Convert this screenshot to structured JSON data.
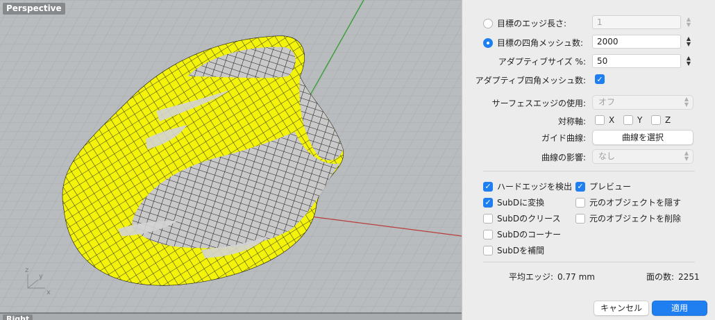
{
  "viewport": {
    "title": "Perspective",
    "second_title": "Right",
    "axis_labels": {
      "x": "x",
      "y": "y",
      "z": "z"
    }
  },
  "panel": {
    "edge_length": {
      "label": "目標のエッジ長さ:",
      "value": "1",
      "selected": false
    },
    "quad_count": {
      "label": "目標の四角メッシュ数:",
      "value": "2000",
      "selected": true
    },
    "adaptive_size": {
      "label": "アダプティブサイズ %:",
      "value": "50"
    },
    "adaptive_quad": {
      "label": "アダプティブ四角メッシュ数:",
      "checked": true
    },
    "surface_edges": {
      "label": "サーフェスエッジの使用:",
      "value": "オフ"
    },
    "symmetry": {
      "label": "対称軸:",
      "x": "X",
      "y": "Y",
      "z": "Z"
    },
    "guide_curves": {
      "label": "ガイド曲線:",
      "button": "曲線を選択"
    },
    "curve_influence": {
      "label": "曲線の影響:",
      "value": "なし"
    },
    "options": {
      "detect_hard_edges": {
        "label": "ハードエッジを検出",
        "checked": true
      },
      "preview": {
        "label": "プレビュー",
        "checked": true
      },
      "convert_subd": {
        "label": "SubDに変換",
        "checked": true
      },
      "hide_original": {
        "label": "元のオブジェクトを隠す",
        "checked": false
      },
      "subd_crease": {
        "label": "SubDのクリース",
        "checked": false
      },
      "delete_original": {
        "label": "元のオブジェクトを削除",
        "checked": false
      },
      "subd_corner": {
        "label": "SubDのコーナー",
        "checked": false
      },
      "subd_interpolate": {
        "label": "SubDを補間",
        "checked": false
      }
    },
    "stats": {
      "avg_edge_label": "平均エッジ:",
      "avg_edge_value": "0.77 mm",
      "face_count_label": "面の数:",
      "face_count_value": "2251"
    },
    "buttons": {
      "cancel": "キャンセル",
      "apply": "適用"
    }
  },
  "colors": {
    "accent": "#1f7ff1",
    "mesh_fill": "#f4f30a",
    "viewport_bg": "#b9bcbe"
  }
}
